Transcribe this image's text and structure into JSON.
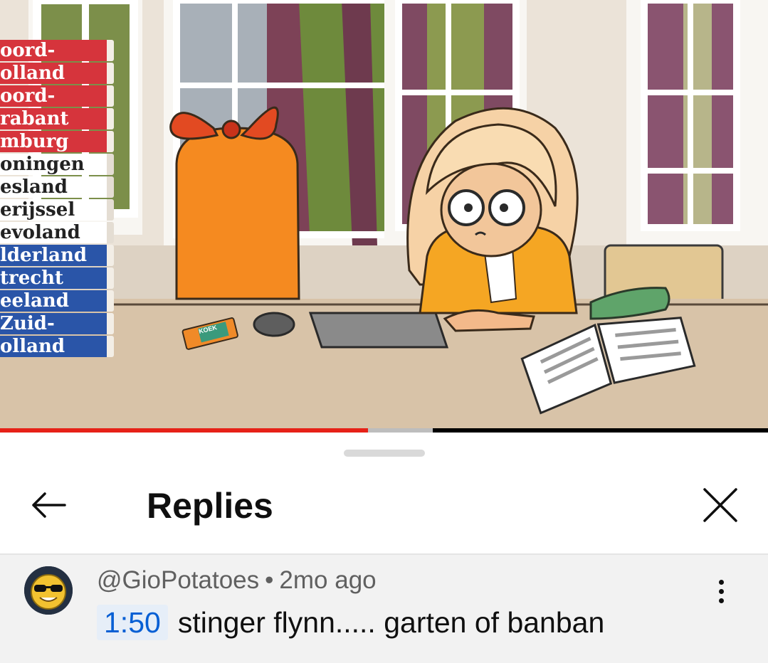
{
  "video": {
    "book_labels": [
      "oord-",
      "olland",
      "oord-",
      "rabant",
      "mburg",
      "oningen",
      "esland",
      "erijssel",
      "evoland",
      "lderland",
      "trecht",
      "eeland",
      "Zuid-",
      "olland"
    ],
    "snack_label": "KOEK",
    "progress_fraction": 0.479
  },
  "sheet": {
    "title": "Replies"
  },
  "comment": {
    "author": "@GioPotatoes",
    "separator": "•",
    "age": "2mo ago",
    "timestamp": "1:50",
    "text": "stinger flynn..... garten of banban"
  },
  "colors": {
    "progress_played": "#e62117",
    "timestamp_link": "#065fd4",
    "comment_background": "#f2f2f2"
  },
  "icons": {
    "back": "arrow-left-icon",
    "close": "close-icon",
    "more": "more-vertical-icon",
    "avatar": "sunglasses-emoji-avatar"
  }
}
